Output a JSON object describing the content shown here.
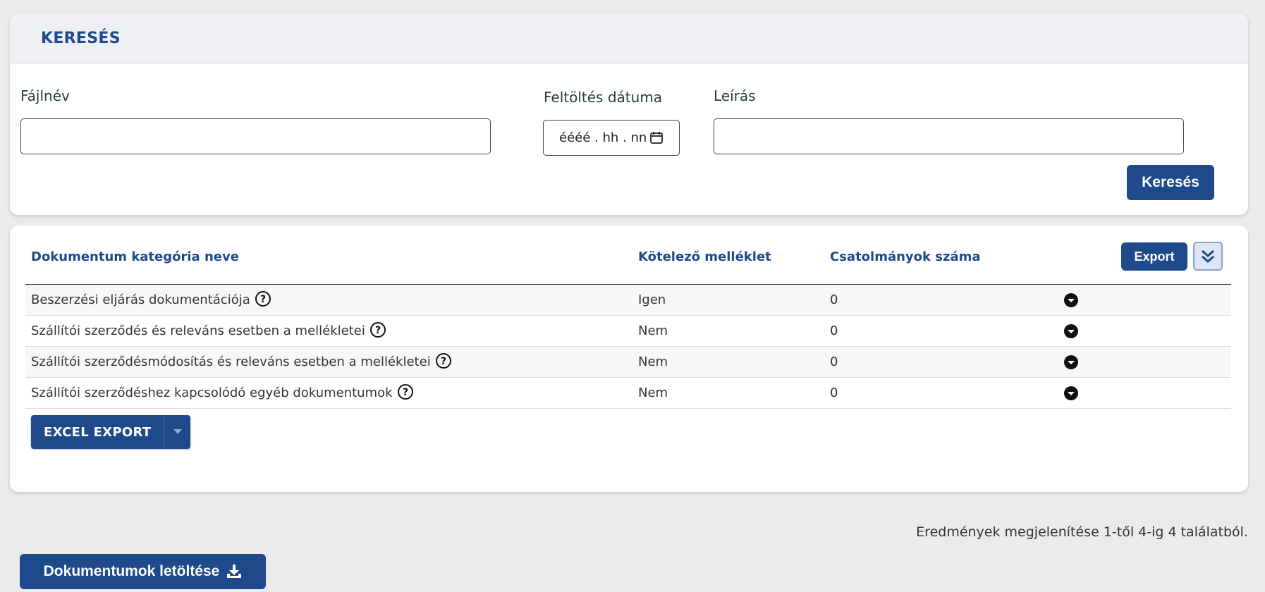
{
  "search": {
    "title": "KERESÉS",
    "filename_label": "Fájlnév",
    "filename_value": "",
    "upload_date_label": "Feltöltés dátuma",
    "upload_date_placeholder": "éééé . hh . nn",
    "description_label": "Leírás",
    "description_value": "",
    "search_button": "Keresés"
  },
  "table": {
    "columns": [
      "Dokumentum kategória neve",
      "Kötelező melléklet",
      "Csatolmányok száma"
    ],
    "export_button": "Export",
    "rows": [
      {
        "name": "Beszerzési eljárás dokumentációja",
        "required": "Igen",
        "count": "0"
      },
      {
        "name": "Szállítói szerződés és releváns esetben a mellékletei",
        "required": "Nem",
        "count": "0"
      },
      {
        "name": "Szállítói szerződésmódosítás és releváns esetben a mellékletei",
        "required": "Nem",
        "count": "0"
      },
      {
        "name": "Szállítói szerződéshez kapcsolódó egyéb dokumentumok",
        "required": "Nem",
        "count": "0"
      }
    ],
    "excel_export_button": "EXCEL EXPORT"
  },
  "footer": {
    "result_summary": "Eredmények megjelenítése 1-től 4-ig 4 találatból.",
    "download_button": "Dokumentumok letöltése"
  },
  "icons": {
    "help": "question-circle-icon",
    "row_toggle": "caret-down-circle-icon",
    "calendar": "calendar-icon",
    "collapse": "double-chevron-down-icon",
    "download": "download-icon"
  },
  "colors": {
    "accent": "#1e4a8c",
    "background": "#ebebeb",
    "header_band": "#eef0f4"
  }
}
